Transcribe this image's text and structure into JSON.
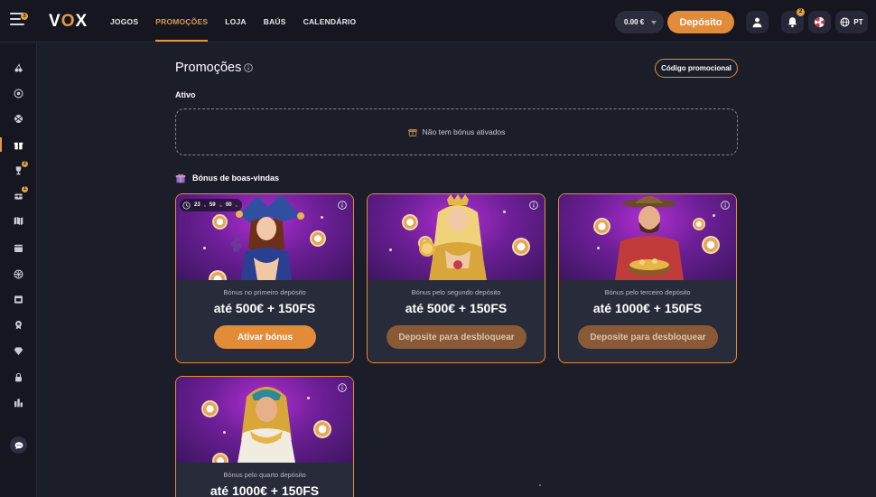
{
  "header": {
    "menu_badge": "3",
    "logo_v": "V",
    "logo_o": "O",
    "logo_x": "X",
    "nav": [
      "JOGOS",
      "PROMOÇÕES",
      "LOJA",
      "BAÚS",
      "CALENDÁRIO"
    ],
    "active_nav": "PROMOÇÕES",
    "balance": "0.00 €",
    "deposit_label": "Depósito",
    "notifications_badge": "2",
    "language": "PT"
  },
  "sidebar": {
    "items": [
      {
        "icon": "cherries-icon"
      },
      {
        "icon": "live-casino-icon"
      },
      {
        "icon": "sports-ball-icon"
      },
      {
        "icon": "gift-icon",
        "active": true
      },
      {
        "icon": "trophy-icon",
        "badge": "2"
      },
      {
        "icon": "chest-icon",
        "badge": "1"
      },
      {
        "icon": "map-icon"
      },
      {
        "icon": "calendar-icon"
      },
      {
        "icon": "wheel-icon"
      },
      {
        "icon": "store-icon"
      },
      {
        "icon": "badge-icon"
      },
      {
        "icon": "diamond-icon"
      },
      {
        "icon": "lock-icon"
      },
      {
        "icon": "leaderboard-icon"
      }
    ]
  },
  "main": {
    "title": "Promoções",
    "promo_code_label": "Código promocional",
    "active_section": "Ativo",
    "empty_text": "Não tem bónus ativados",
    "welcome_title": "Bónus de boas-vindas",
    "cards": [
      {
        "subtitle": "Bónus no primeiro depósito",
        "amount": "até 500€ + 150FS",
        "button": "Ativar bónus",
        "timer": {
          "h": "23",
          "m": "59",
          "s": "00"
        }
      },
      {
        "subtitle": "Bónus pelo segundo depósito",
        "amount": "até 500€ + 150FS",
        "button": "Deposite para desbloquear"
      },
      {
        "subtitle": "Bónus pelo terceiro depósito",
        "amount": "até 1000€ + 150FS",
        "button": "Deposite para desbloquear"
      },
      {
        "subtitle": "Bónus pelo quarto depósito",
        "amount": "até 1000€ + 150FS"
      }
    ]
  },
  "colors": {
    "accent": "#e28c3a",
    "background": "#1b1d29",
    "card": "#282b3a"
  }
}
